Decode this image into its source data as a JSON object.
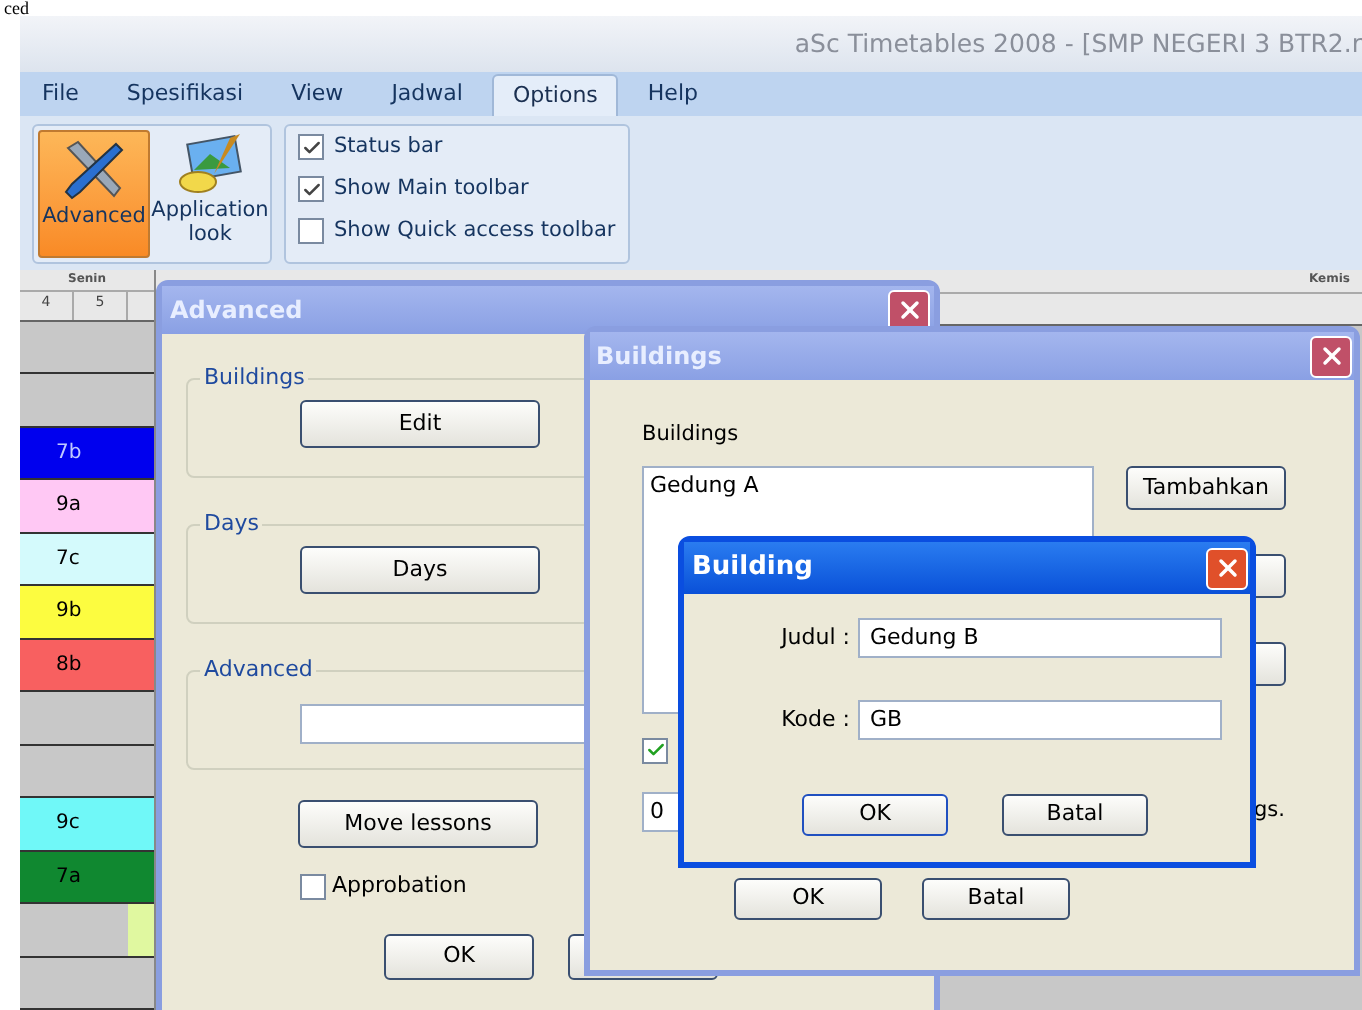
{
  "page_fragment": "ced",
  "app": {
    "title": "aSc Timetables 2008  - [SMP NEGERI 3 BTR2.r",
    "menu_tabs": [
      {
        "label": "File",
        "selected": false
      },
      {
        "label": "Spesifikasi",
        "selected": false
      },
      {
        "label": "View",
        "selected": false
      },
      {
        "label": "Jadwal",
        "selected": false
      },
      {
        "label": "Options",
        "selected": true
      },
      {
        "label": "Help",
        "selected": false
      }
    ],
    "ribbon_buttons": [
      {
        "label": "Advanced",
        "selected": true,
        "kind": "tools"
      },
      {
        "label": "Application look",
        "selected": false,
        "kind": "look"
      }
    ],
    "ribbon_options": [
      {
        "label": "Status bar",
        "checked": true
      },
      {
        "label": "Show Main toolbar",
        "checked": true
      },
      {
        "label": "Show Quick access toolbar",
        "checked": false
      }
    ]
  },
  "timetable": {
    "day_left": "Senin",
    "periods": [
      "4",
      "5"
    ],
    "day_right": "Kemis",
    "rows": [
      {
        "color": "#c8c8c8"
      },
      {
        "color": "#c8c8c8"
      },
      {
        "label": "7b",
        "color": "#0000ee"
      },
      {
        "label": "9a",
        "color": "#ffc8f4"
      },
      {
        "label": "7c",
        "color": "#d4fafc"
      },
      {
        "label": "9b",
        "color": "#fcfc40"
      },
      {
        "label": "8b",
        "color": "#f86060"
      },
      {
        "color": "#c8c8c8"
      },
      {
        "color": "#c8c8c8"
      },
      {
        "label": "9c",
        "color": "#70f8f8"
      },
      {
        "label": "7a",
        "color": "#108830"
      },
      {
        "color": "#c8c8c8",
        "cards": [
          {
            "color": "#e0f8a0"
          }
        ]
      },
      {
        "color": "#c8c8c8"
      }
    ]
  },
  "advanced_dialog": {
    "title": "Advanced",
    "groups": [
      {
        "title": "Buildings",
        "kind": "button",
        "button": "Edit"
      },
      {
        "title": "Days",
        "kind": "button",
        "button": "Days"
      },
      {
        "title": "Advanced",
        "kind": "field"
      }
    ],
    "move_button": "Move lessons",
    "approbation": {
      "label": "Approbation",
      "checked": false
    },
    "ok": "OK"
  },
  "buildings_dialog": {
    "title": "Buildings",
    "list_label": "Buildings",
    "items": [
      "Gedung A"
    ],
    "add_button": "Tambahkan",
    "option_checked": true,
    "number_value": "0",
    "note_fragment": "gs.",
    "ok": "OK",
    "cancel": "Batal"
  },
  "building_dialog": {
    "title": "Building",
    "fields": [
      {
        "label": "Judul :",
        "value": "Gedung B"
      },
      {
        "label": "Kode :",
        "value": "GB"
      }
    ],
    "ok": "OK",
    "cancel": "Batal"
  }
}
